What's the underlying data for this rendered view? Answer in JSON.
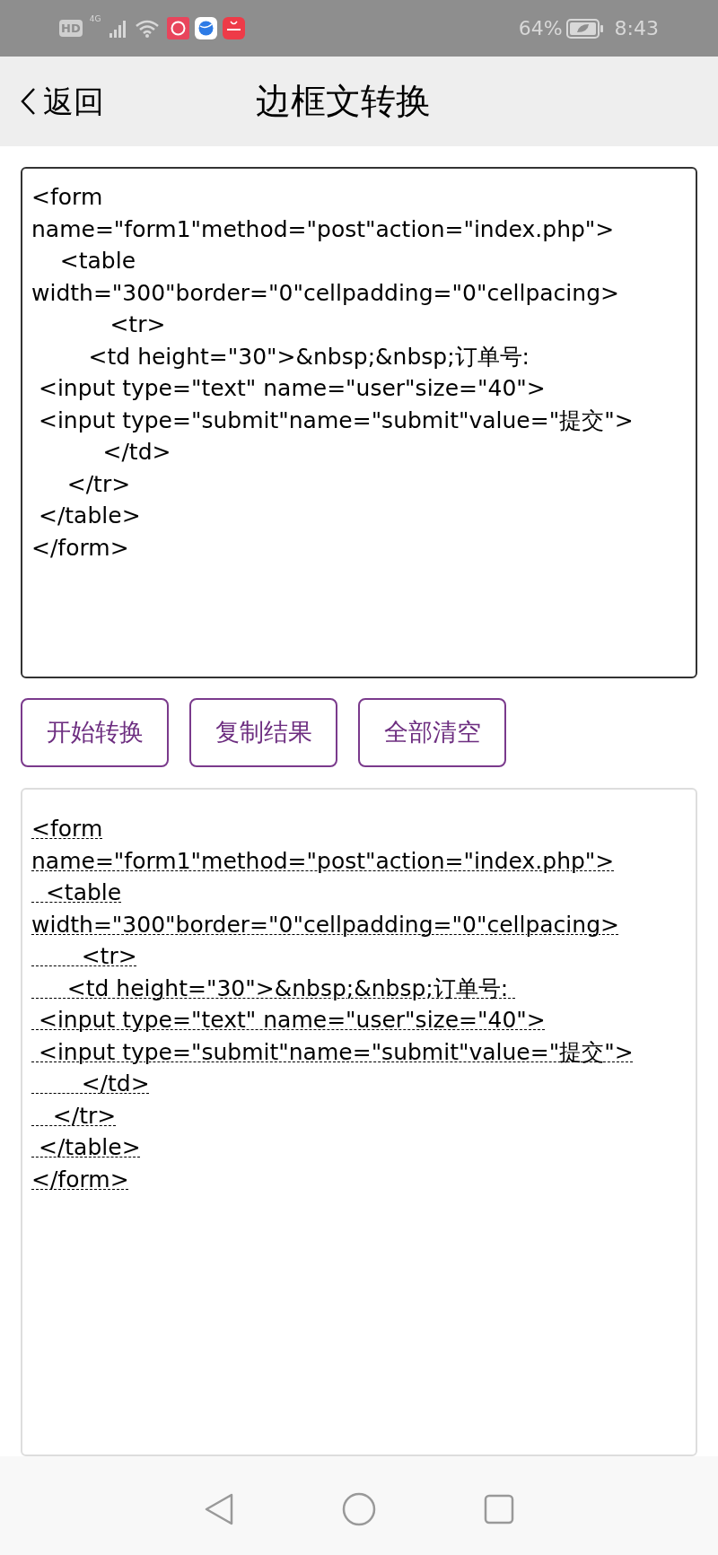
{
  "status_bar": {
    "hd": "HD",
    "network": "4G",
    "battery_percent": "64%",
    "time": "8:43"
  },
  "header": {
    "back": "返回",
    "title": "边框文转换"
  },
  "input": {
    "lines": [
      "<form",
      "name=\"form1\"method=\"post\"action=\"index.php\">",
      "    <table",
      "width=\"300\"border=\"0\"cellpadding=\"0\"cellpacing>",
      "           <tr>",
      "        <td height=\"30\">&nbsp;&nbsp;订单号:",
      " <input type=\"text\" name=\"user\"size=\"40\">",
      " <input type=\"submit\"name=\"submit\"value=\"提交\">",
      "          </td>",
      "     </tr>",
      " </table>",
      "</form>"
    ]
  },
  "buttons": [
    {
      "label": "开始转换"
    },
    {
      "label": "复制结果"
    },
    {
      "label": "全部清空"
    }
  ],
  "output": {
    "lines": [
      "<form",
      "name=\"form1\"method=\"post\"action=\"index.php\">",
      "  <table",
      "width=\"300\"border=\"0\"cellpadding=\"0\"cellpacing>",
      "       <tr>",
      "     <td height=\"30\">&nbsp;&nbsp;订单号: ",
      " <input type=\"text\" name=\"user\"size=\"40\">",
      " <input type=\"submit\"name=\"submit\"value=\"提交\">",
      "       </td>",
      "   </tr>",
      " </table>",
      "</form>"
    ]
  }
}
